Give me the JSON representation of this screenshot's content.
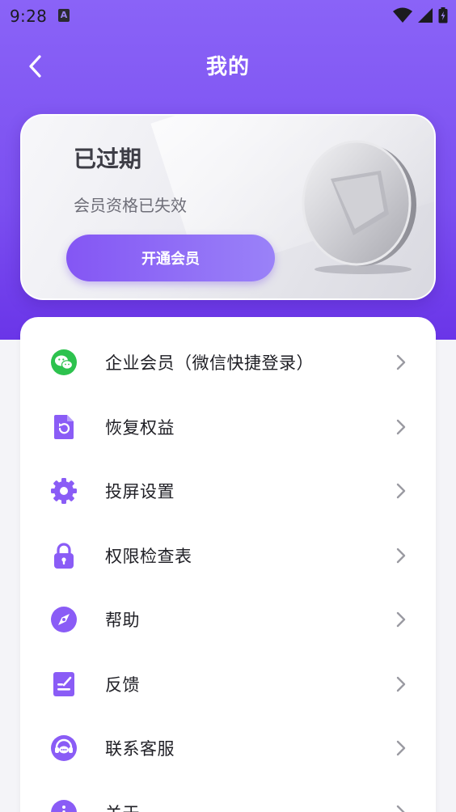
{
  "status_bar": {
    "time": "9:28",
    "icons": [
      "a-icon",
      "wifi-icon",
      "signal-icon",
      "battery-icon"
    ]
  },
  "header": {
    "title": "我的",
    "back_icon": "chevron-left-icon"
  },
  "member_card": {
    "status": "已过期",
    "subtitle": "会员资格已失效",
    "button_label": "开通会员"
  },
  "menu": {
    "items": [
      {
        "label": "企业会员（微信快捷登录）",
        "icon": "wechat-icon",
        "icon_color": "#2dc24e"
      },
      {
        "label": "恢复权益",
        "icon": "restore-icon",
        "icon_color": "#8a5cf6"
      },
      {
        "label": "投屏设置",
        "icon": "gear-icon",
        "icon_color": "#8a5cf6"
      },
      {
        "label": "权限检查表",
        "icon": "lock-icon",
        "icon_color": "#8a5cf6"
      },
      {
        "label": "帮助",
        "icon": "compass-icon",
        "icon_color": "#8a5cf6"
      },
      {
        "label": "反馈",
        "icon": "feedback-icon",
        "icon_color": "#8a5cf6"
      },
      {
        "label": "联系客服",
        "icon": "headset-icon",
        "icon_color": "#8a5cf6"
      },
      {
        "label": "关于",
        "icon": "info-icon",
        "icon_color": "#8a5cf6"
      }
    ]
  },
  "colors": {
    "header_purple": "#7b4ff0",
    "accent": "#8a5cf6",
    "wechat_green": "#2dc24e"
  }
}
